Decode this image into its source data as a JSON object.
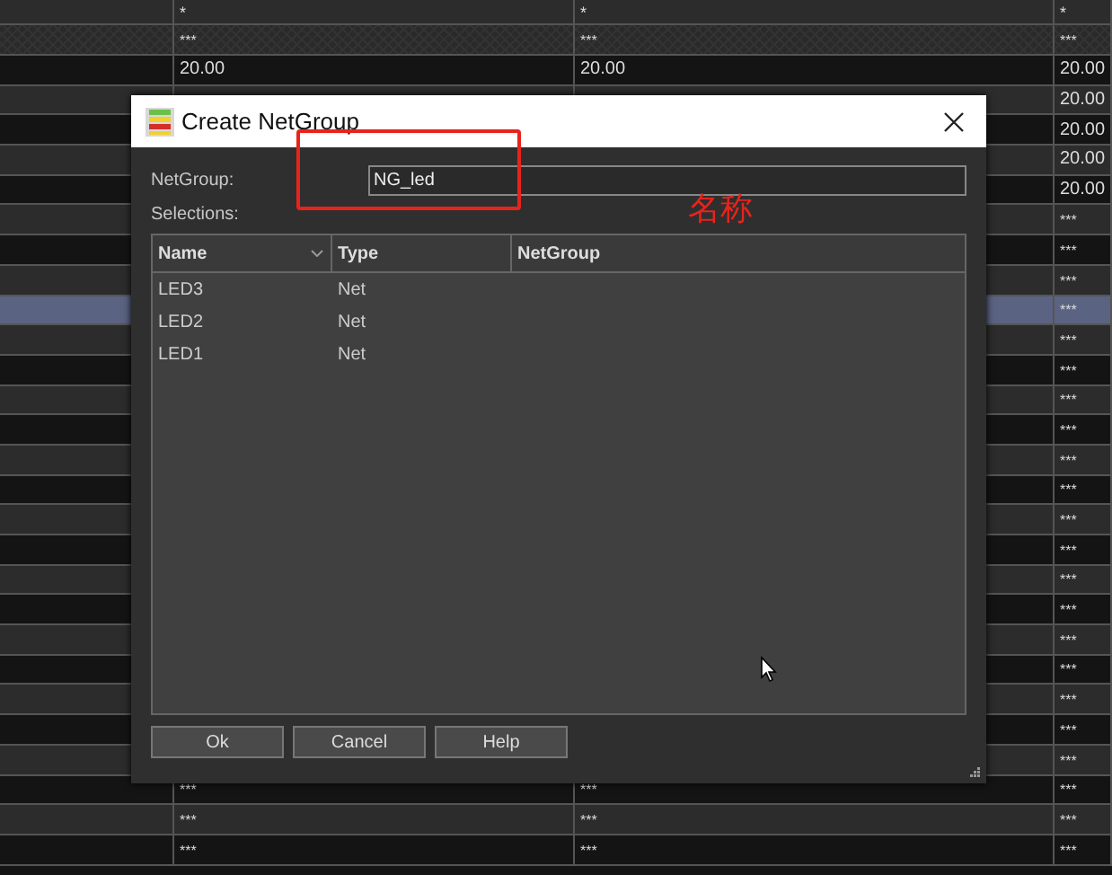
{
  "grid": {
    "header": {
      "column_2": "*",
      "column_3": "*",
      "column_4": "*"
    },
    "filter_row": {
      "column_2": "***",
      "column_3": "***",
      "column_4": "***"
    },
    "rows": [
      {
        "selected": false,
        "column_2": "20.00",
        "column_3": "20.00",
        "column_4": "20.00"
      },
      {
        "selected": false,
        "column_4": "20.00"
      },
      {
        "selected": false,
        "column_4": "20.00"
      },
      {
        "selected": false,
        "column_4": "20.00"
      },
      {
        "selected": false,
        "column_4": "20.00"
      },
      {
        "selected": false,
        "column_4": "***"
      },
      {
        "selected": false,
        "column_4": "***"
      },
      {
        "selected": false,
        "column_4": "***"
      },
      {
        "selected": true,
        "column_4": "***"
      },
      {
        "selected": false,
        "column_4": "***"
      },
      {
        "selected": false,
        "column_4": "***"
      },
      {
        "selected": false,
        "column_4": "***"
      },
      {
        "selected": false,
        "column_4": "***"
      },
      {
        "selected": false,
        "column_4": "***"
      },
      {
        "selected": false,
        "column_4": "***"
      },
      {
        "selected": false,
        "column_4": "***"
      },
      {
        "selected": false,
        "column_4": "***"
      },
      {
        "selected": false,
        "column_4": "***"
      },
      {
        "selected": false,
        "column_4": "***"
      },
      {
        "selected": false,
        "column_4": "***"
      },
      {
        "selected": false,
        "column_4": "***"
      },
      {
        "selected": false,
        "column_4": "***"
      },
      {
        "selected": false,
        "column_4": "***"
      },
      {
        "selected": false,
        "column_4": "***"
      },
      {
        "selected": false,
        "column_2": "***",
        "column_3": "***",
        "column_4": "***"
      },
      {
        "selected": false,
        "column_2": "***",
        "column_3": "***",
        "column_4": "***"
      },
      {
        "selected": false,
        "column_2": "***",
        "column_3": "***",
        "column_4": "***"
      }
    ]
  },
  "dialog": {
    "title": "Create NetGroup",
    "netgroup_label": "NetGroup:",
    "netgroup_value": "NG_led",
    "selections_label": "Selections:",
    "columns": [
      {
        "label": "Name",
        "sorted": true
      },
      {
        "label": "Type",
        "sorted": false
      },
      {
        "label": "NetGroup",
        "sorted": false
      }
    ],
    "rows": [
      {
        "name": "LED3",
        "type": "Net"
      },
      {
        "name": "LED2",
        "type": "Net"
      },
      {
        "name": "LED1",
        "type": "Net"
      }
    ],
    "buttons": [
      "Ok",
      "Cancel",
      "Help"
    ]
  },
  "annotation": {
    "label": "名称"
  }
}
